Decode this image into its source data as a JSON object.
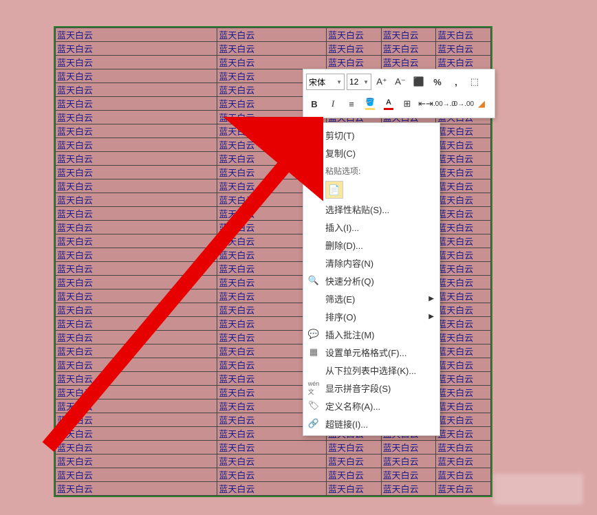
{
  "cell_text": "蓝天白云",
  "rows": 34,
  "mini_toolbar": {
    "font_name": "宋体",
    "font_size": "12",
    "increase_font": "A⁺",
    "decrease_font": "A⁻",
    "percent": "%",
    "comma": ",",
    "bold": "B",
    "italic": "I"
  },
  "context_menu": {
    "cut": "剪切(T)",
    "copy": "复制(C)",
    "paste_options_label": "粘贴选项:",
    "paste_special": "选择性粘贴(S)...",
    "insert": "插入(I)...",
    "delete": "删除(D)...",
    "clear_contents": "清除内容(N)",
    "quick_analysis": "快速分析(Q)",
    "filter": "筛选(E)",
    "sort": "排序(O)",
    "insert_comment": "插入批注(M)",
    "format_cells": "设置单元格格式(F)...",
    "pick_from_dropdown": "从下拉列表中选择(K)...",
    "show_pinyin": "显示拼音字段(S)",
    "define_name": "定义名称(A)...",
    "hyperlink": "超链接(I)..."
  }
}
